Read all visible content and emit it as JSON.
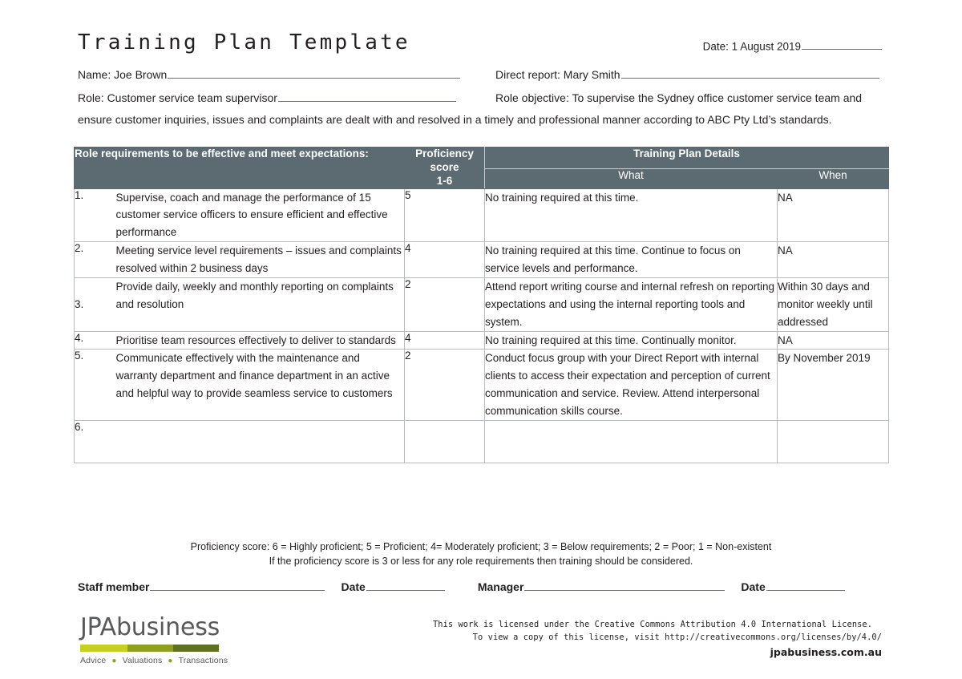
{
  "document": {
    "title": "Training Plan Template",
    "date_label": "Date: 1 August 2019"
  },
  "fields": {
    "name_label": "Name: Joe Brown",
    "direct_report_label": "Direct report: Mary Smith",
    "role_label": "Role: Customer service team supervisor",
    "role_objective_label": "Role objective: To supervise the Sydney office customer service team and",
    "role_objective_cont": "ensure customer inquiries, issues and complaints are dealt with and resolved in a timely and professional manner according to ABC Pty Ltd’s standards."
  },
  "table": {
    "headers": {
      "requirements": "Role requirements to be effective and meet expectations:",
      "proficiency_line1": "Proficiency",
      "proficiency_line2": "score",
      "proficiency_line3": "1-6",
      "training_plan_details": "Training Plan Details",
      "what": "What",
      "when": "When"
    },
    "rows": [
      {
        "num": "1.",
        "requirement": "Supervise, coach and manage the performance of 15 customer service officers to ensure efficient and effective performance",
        "score": "5",
        "what": "No training required at this time.",
        "when": "NA"
      },
      {
        "num": "2.",
        "requirement": "Meeting service level requirements – issues and complaints resolved within 2 business days",
        "score": "4",
        "what": "No training required at this time. Continue to focus on service levels and performance.",
        "when": "NA"
      },
      {
        "num": "3.",
        "requirement": "Provide daily, weekly and monthly reporting on complaints and resolution",
        "score": "2",
        "what": "Attend report writing course and internal refresh on reporting expectations and using the internal reporting tools and system.",
        "when": "Within 30 days and monitor weekly until addressed"
      },
      {
        "num": "4.",
        "requirement": "Prioritise team resources effectively to deliver to standards",
        "score": "4",
        "what": "No training required at this time. Continually monitor.",
        "when": "NA"
      },
      {
        "num": "5.",
        "requirement": "Communicate effectively with the maintenance and warranty department and finance department in an active and helpful way to provide seamless service to customers",
        "score": "2",
        "what": "Conduct focus group with your Direct Report with internal clients to access their expectation and perception of current communication and service. Review. Attend interpersonal communication skills course.",
        "when": "By November 2019"
      },
      {
        "num": "6.",
        "requirement": "",
        "score": "",
        "what": "",
        "when": ""
      }
    ]
  },
  "notes": {
    "line1": "Proficiency score: 6 = Highly proficient; 5 = Proficient; 4= Moderately proficient; 3 = Below requirements; 2 = Poor; 1 = Non-existent",
    "line2": "If the proficiency score is 3 or less for any role requirements then training should be considered."
  },
  "signature": {
    "staff_member": "Staff member",
    "date_1": "Date",
    "manager": "Manager",
    "date_2": "Date"
  },
  "logo": {
    "wordmark": "JPAbusiness",
    "tagline_1": "Advice",
    "tagline_2": "Valuations",
    "tagline_3": "Transactions",
    "bar_color_1": "#c6d020",
    "bar_color_2": "#8fa01f",
    "bar_color_3": "#5f7021"
  },
  "license": {
    "line1": "This work is licensed under the Creative Commons Attribution 4.0 International License.",
    "line2": "To view a copy of this license, visit http://creativecommons.org/licenses/by/4.0/",
    "website": "jpabusiness.com.au"
  },
  "colors": {
    "header_bg": "#5c6a72",
    "border": "#b8bcc0",
    "text": "#231f20"
  }
}
